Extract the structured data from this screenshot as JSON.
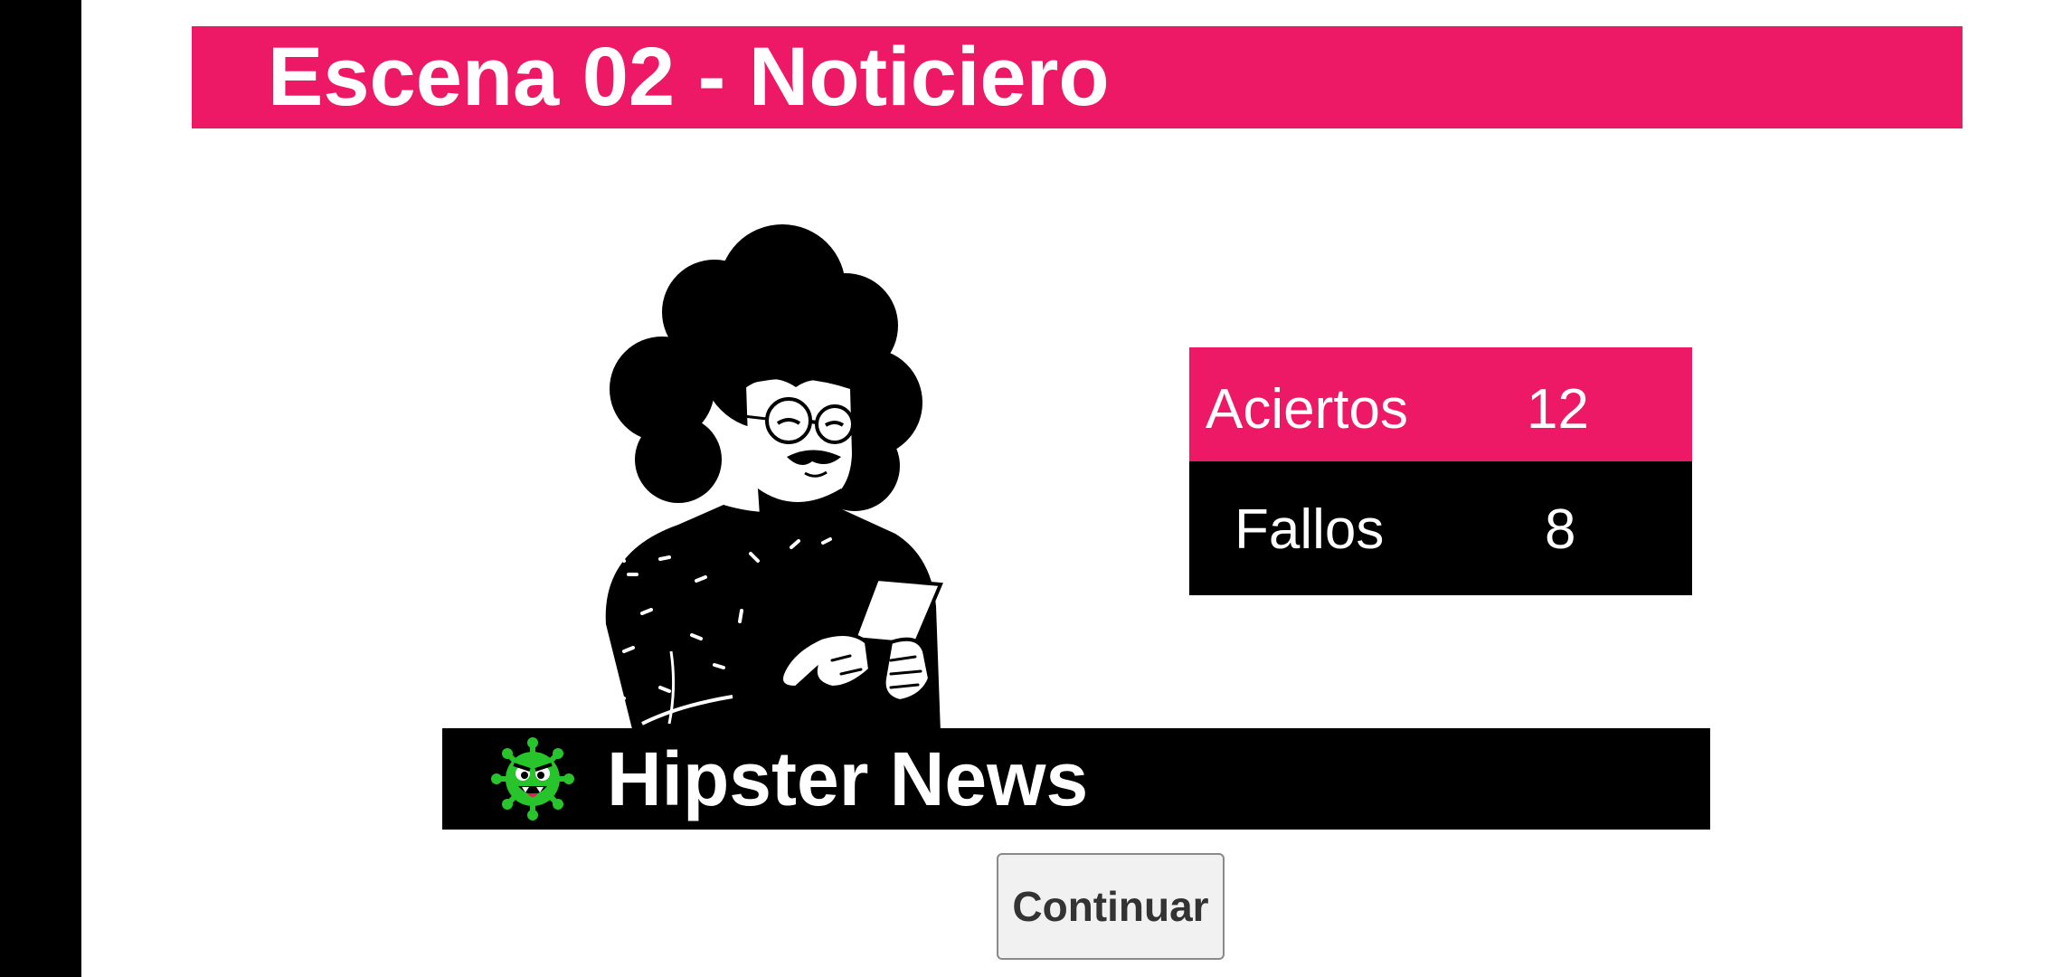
{
  "scene": {
    "title": "Escena 02 - Noticiero"
  },
  "character": {
    "icon": "hipster-reporter-illustration"
  },
  "score": {
    "hits_label": "Aciertos",
    "hits_value": "12",
    "misses_label": "Fallos",
    "misses_value": "8"
  },
  "news": {
    "logo_icon": "virus-icon",
    "title": "Hipster News"
  },
  "actions": {
    "continue_label": "Continuar"
  },
  "colors": {
    "accent": "#ee1966",
    "dark": "#000000",
    "virus": "#27c52b"
  }
}
